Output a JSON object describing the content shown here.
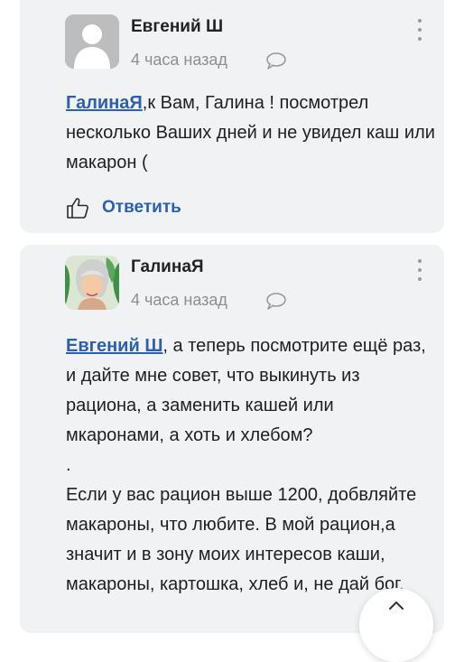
{
  "comments": [
    {
      "author": "Евгений Ш",
      "time": "4 часа назад",
      "avatar": "default-user-avatar",
      "mention": "ГалинаЯ",
      "text": ",к Вам, Галина ! посмотрел несколько Ваших дней и не увидел каш или макарон (",
      "reply_label": "Ответить"
    },
    {
      "author": "ГалинаЯ",
      "time": "4 часа назад",
      "avatar": "user-photo-avatar",
      "mention": "Евгений Ш",
      "text": ", а теперь посмотрите ещё раз, и дайте мне совет, что выкинуть из рациона, а заменить кашей или мкаронами, а хоть и хлебом?",
      "dot": ".",
      "text2": "Если у вас рацион выше 1200, добвляйте макароны, что любите. В мой рацион,а значит и в зону моих интересов каши, макароны, картошка, хлеб и, не дай бог,"
    }
  ],
  "icons": {
    "reply": "thumbs-up-icon",
    "comment": "speech-bubble-icon",
    "more": "more-vertical-icon",
    "scroll": "chevron-up-icon"
  },
  "colors": {
    "link": "#2b5fb1",
    "card": "#f1f2f4",
    "muted": "#8e8e8e"
  }
}
